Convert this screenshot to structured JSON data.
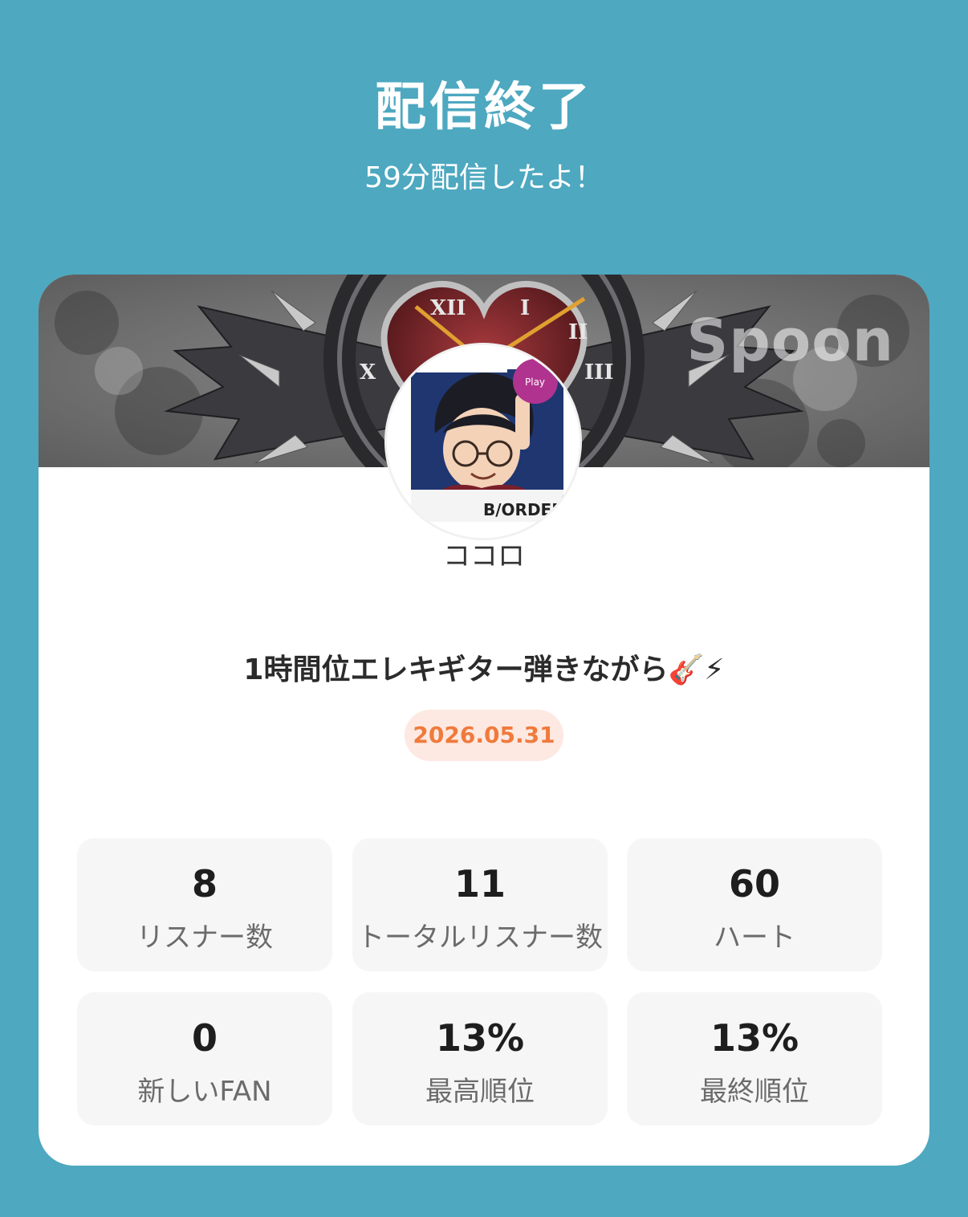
{
  "header": {
    "title": "配信終了",
    "subtitle": "59分配信したよ！"
  },
  "card": {
    "banner_watermark": "Spoon",
    "username": "ココロ",
    "live_title": "1時間位エレキギター弾きながら🎸⚡",
    "date": "2026.05.31",
    "stats": [
      {
        "value": "8",
        "label": "リスナー数"
      },
      {
        "value": "11",
        "label": "トータルリスナー数"
      },
      {
        "value": "60",
        "label": "ハート"
      },
      {
        "value": "0",
        "label": "新しいFAN"
      },
      {
        "value": "13%",
        "label": "最高順位"
      },
      {
        "value": "13%",
        "label": "最終順位"
      }
    ]
  },
  "colors": {
    "background": "#4da8c0",
    "card": "#ffffff",
    "stat_tile": "#f6f6f6",
    "date_text": "#f07a3c",
    "date_badge": "#fde9e2"
  },
  "icons": {
    "banner": "heart-clock-wings-artwork",
    "avatar": "anime-character-guitarist-avatar"
  }
}
